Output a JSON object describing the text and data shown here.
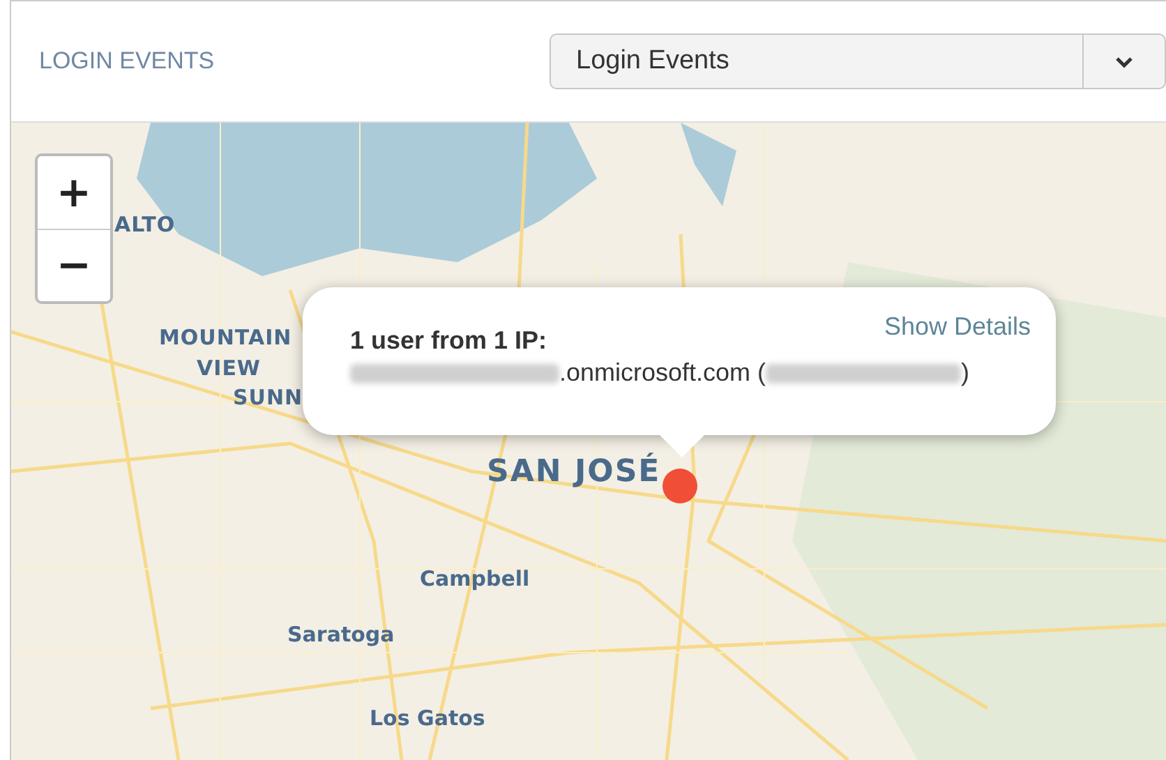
{
  "panel": {
    "title": "LOGIN EVENTS"
  },
  "dropdown": {
    "value": "Login Events"
  },
  "map": {
    "zoom_controls": [
      {
        "label": "+"
      },
      {
        "label": "−"
      }
    ],
    "labels": [
      {
        "text": "ALTO",
        "kind": "city"
      },
      {
        "text": "MOUNTAIN",
        "kind": "city"
      },
      {
        "text": "VIEW",
        "kind": "city"
      },
      {
        "text": "SUNN",
        "kind": "city"
      },
      {
        "text": "SAN JOSÉ",
        "kind": "major"
      },
      {
        "text": "Campbell",
        "kind": "town"
      },
      {
        "text": "Saratoga",
        "kind": "town"
      },
      {
        "text": "Los Gatos",
        "kind": "town"
      }
    ],
    "marker": {
      "color": "#f04e37"
    },
    "popup": {
      "heading": "1 user from 1 IP:",
      "domain": ".onmicrosoft.com (",
      "close": ")",
      "link": "Show Details"
    }
  }
}
